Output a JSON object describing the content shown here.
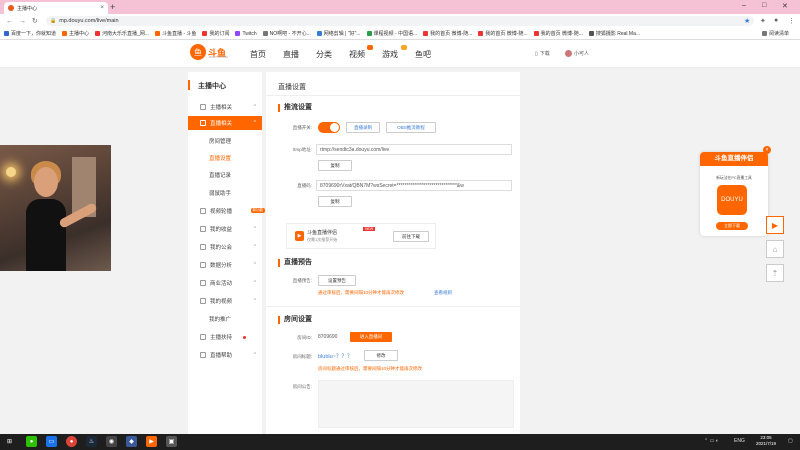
{
  "browser": {
    "tab_title": "主播中心",
    "url": "mp.douyu.com/live/main",
    "bookmarks": [
      "百度一下，你就知道",
      "主播中心",
      "河南大乐乐直播_网...",
      "斗鱼直播 - 斗鱼",
      "我的订阅",
      "Twitch",
      "NO啊吧 - 不开心...",
      "网络剪辑 | \"好\"...",
      "课程视频 - 中国语...",
      "我的首页 微博-随...",
      "我的首页 微博-随...",
      "我的首页 微博-随...",
      "搜狐摄影 Real Ma..."
    ],
    "reading_list": "阅读清单"
  },
  "site": {
    "logo_text": "斗鱼",
    "logo_sub": "DOUYU.COM",
    "nav": [
      "首页",
      "直播",
      "分类",
      "视频",
      "游戏",
      "鱼吧"
    ],
    "download": "下载",
    "user": "小可人"
  },
  "sidebar": {
    "title": "主播中心",
    "items": [
      {
        "label": "主播相关",
        "chevron": "^"
      },
      {
        "label": "直播相关",
        "chevron": "^"
      },
      {
        "label": "房间管理"
      },
      {
        "label": "直播设置"
      },
      {
        "label": "直播记录"
      },
      {
        "label": "弱鼠助手"
      },
      {
        "label": "视频轮播",
        "badge": "新功能"
      },
      {
        "label": "我的收益",
        "chevron": "^"
      },
      {
        "label": "我的公会",
        "chevron": "^"
      },
      {
        "label": "数据分析",
        "chevron": "^"
      },
      {
        "label": "商业活动",
        "chevron": "^"
      },
      {
        "label": "我的视频",
        "chevron": "^"
      },
      {
        "label": "我的推广"
      },
      {
        "label": "主播扶持"
      },
      {
        "label": "直播帮助",
        "chevron": "^"
      }
    ]
  },
  "main": {
    "page_title": "直播设置",
    "push": {
      "section": "推流设置",
      "switch_label": "直播开关:",
      "switch_on": true,
      "btn_record": "直播录制",
      "btn_tutorial": "OBS推流教程",
      "rtmp_label": "rtmp地址:",
      "rtmp_value": "rtmp://sendtc3a.douyu.com/live",
      "copy": "复制",
      "code_label": "直播码:",
      "code_value": "8709690rVxat/QBN7M?wsSecret=*******************************&w",
      "copy2": "复制"
    },
    "promo": {
      "title": "斗鱼直播伴侣",
      "new": "NEW",
      "desc": "仅需1次推荐开始",
      "btn": "前往下载"
    },
    "preview": {
      "section": "直播预告",
      "label": "直播预告:",
      "btn": "设置预告",
      "warn": "通过审核后，需要间隔10分钟才能再次修改",
      "link": "查看规则"
    },
    "room": {
      "section": "房间设置",
      "id_label": "房间ID:",
      "id_value": "8709690",
      "id_btn": "进入直播间",
      "title_label": "房间标题:",
      "title_value": "blublu~？？？",
      "title_btn": "修改",
      "title_warn": "房间标题通过审核后，需要间隔10分钟才能再次修改",
      "notice_label": "房间公告:"
    }
  },
  "ad": {
    "title": "斗鱼直播伴侣",
    "text": "新玩法在PC直播工具",
    "icon_text": "DOUYU",
    "btn": "立即下载"
  },
  "taskbar": {
    "lang": "ENG",
    "time": "23:05",
    "date": "2021/7/19"
  },
  "colors": {
    "accent": "#ff6600",
    "tabstrip": "#f4c2d4"
  }
}
